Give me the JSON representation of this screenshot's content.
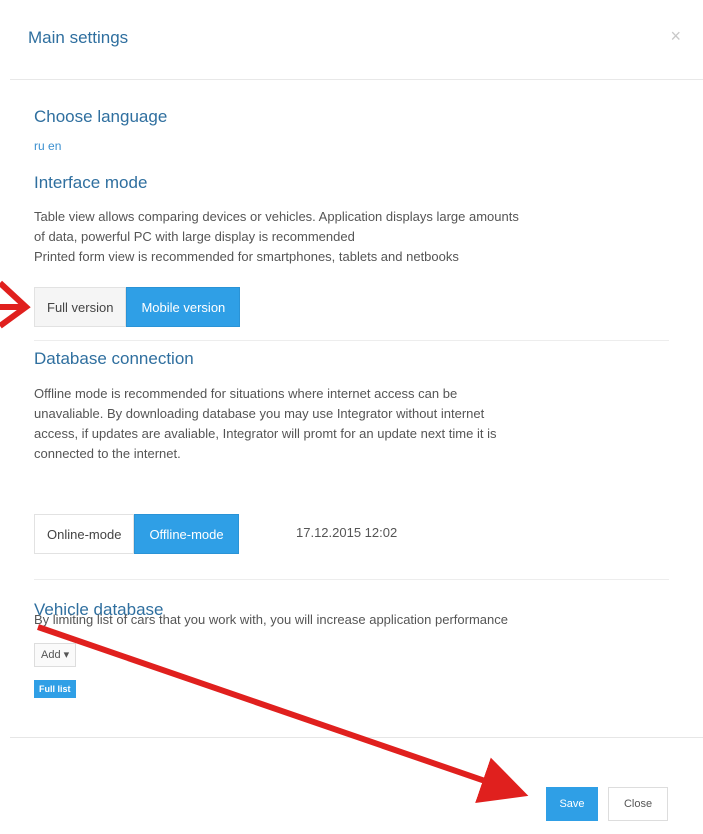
{
  "modal": {
    "title": "Main settings",
    "close_symbol": "×"
  },
  "language": {
    "heading": "Choose language",
    "options": [
      "ru",
      "en"
    ]
  },
  "interface": {
    "heading": "Interface mode",
    "line1": "Table view allows comparing devices or vehicles. Application displays large amounts",
    "line2": "of data, powerful PC with large display is recommended",
    "line3": "Printed form view is recommended for smartphones, tablets and netbooks",
    "buttons": [
      "Full version",
      "Mobile version"
    ],
    "selected": "Mobile version"
  },
  "database": {
    "heading": "Database connection",
    "line1": "Offline mode is recommended for situations where internet access can be",
    "line2": "unavaliable. By downloading database you may use Integrator without internet",
    "line3": "access, if updates are avaliable, Integrator will promt for an update next time it is",
    "line4": "connected to the internet.",
    "buttons": [
      "Online-mode",
      "Offline-mode"
    ],
    "selected": "Offline-mode",
    "timestamp": "17.12.2015 12:02"
  },
  "vehicle": {
    "heading": "Vehicle database",
    "description": "By limiting list of cars that you work with, you will increase application performance",
    "add_label": "Add",
    "full_list_label": "Full list"
  },
  "footer": {
    "save_label": "Save",
    "close_label": "Close"
  },
  "annotations": {
    "arrow_color": "#e0201e"
  },
  "colors": {
    "accent": "#2f9fe6",
    "heading": "#2f6f9f"
  }
}
